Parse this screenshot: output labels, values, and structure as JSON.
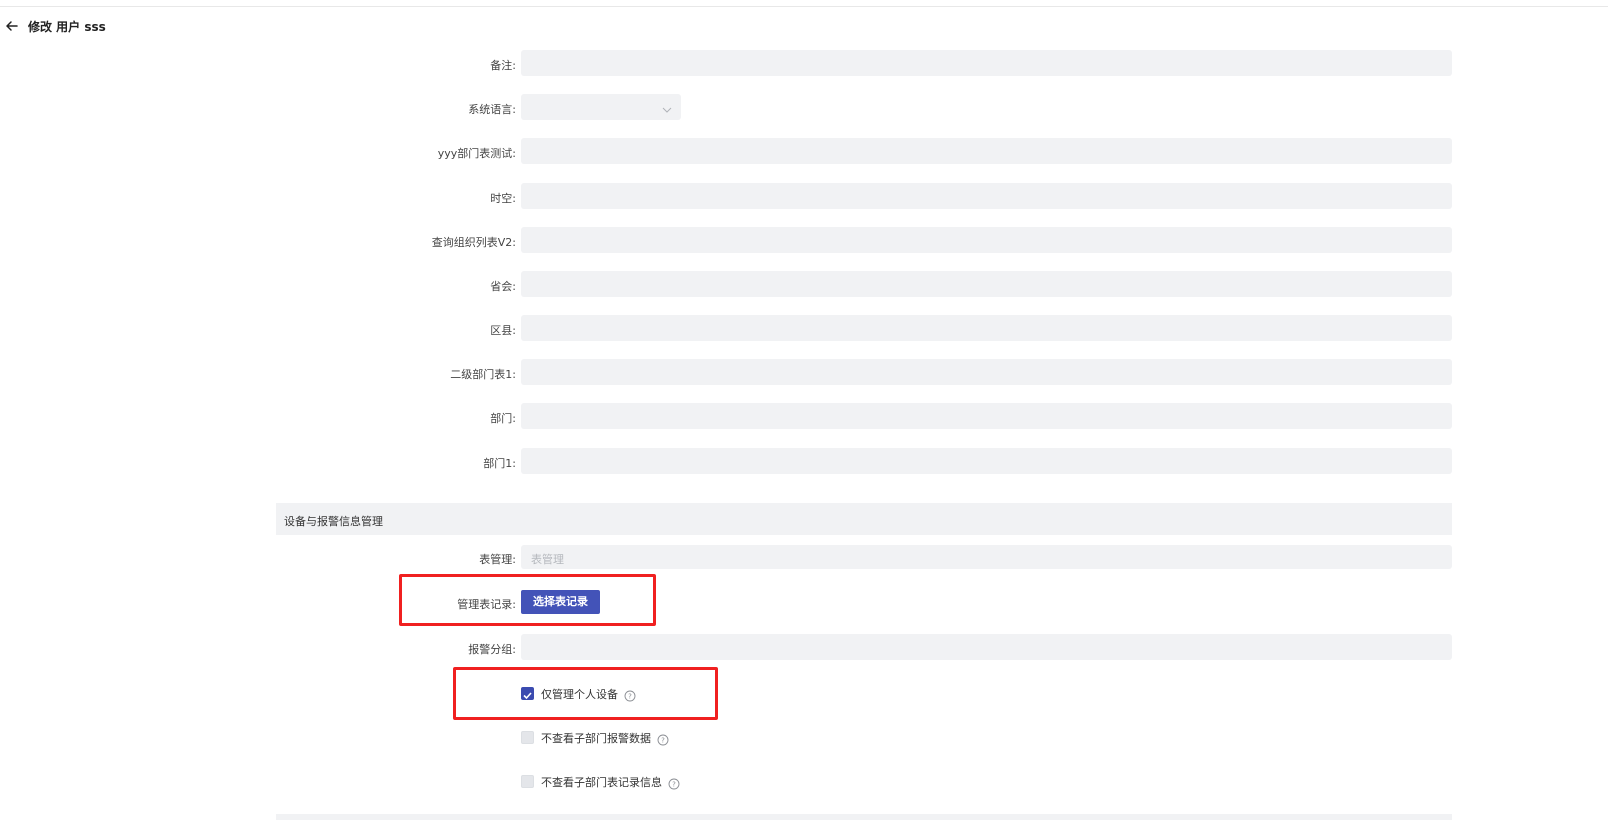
{
  "header": {
    "back_icon": "arrow-left-icon",
    "title": "修改 用户 sss"
  },
  "form": {
    "fields": [
      {
        "label": "备注:",
        "type": "text",
        "value": ""
      },
      {
        "label": "系统语言:",
        "type": "select",
        "value": ""
      },
      {
        "label": "yyy部门表测试:",
        "type": "text",
        "value": ""
      },
      {
        "label": "时空:",
        "type": "text",
        "value": ""
      },
      {
        "label": "查询组织列表V2:",
        "type": "text",
        "value": ""
      },
      {
        "label": "省会:",
        "type": "text",
        "value": ""
      },
      {
        "label": "区县:",
        "type": "text",
        "value": ""
      },
      {
        "label": "二级部门表1:",
        "type": "text",
        "value": ""
      },
      {
        "label": "部门:",
        "type": "text",
        "value": ""
      },
      {
        "label": "部门1:",
        "type": "text",
        "value": ""
      }
    ]
  },
  "section": {
    "title": "设备与报警信息管理",
    "table_mgmt": {
      "label": "表管理:",
      "placeholder": "表管理"
    },
    "table_records": {
      "label": "管理表记录:",
      "button": "选择表记录"
    },
    "alarm_group": {
      "label": "报警分组:",
      "value": ""
    },
    "checkboxes": [
      {
        "label": "仅管理个人设备",
        "checked": true,
        "icon": "question-circle-icon"
      },
      {
        "label": "不查看子部门报警数据",
        "checked": false,
        "icon": "question-circle-icon"
      },
      {
        "label": "不查看子部门表记录信息",
        "checked": false,
        "icon": "question-circle-icon"
      }
    ]
  },
  "colors": {
    "primary": "#4353b8",
    "highlight": "#f02020",
    "input_bg": "#f1f2f4"
  }
}
